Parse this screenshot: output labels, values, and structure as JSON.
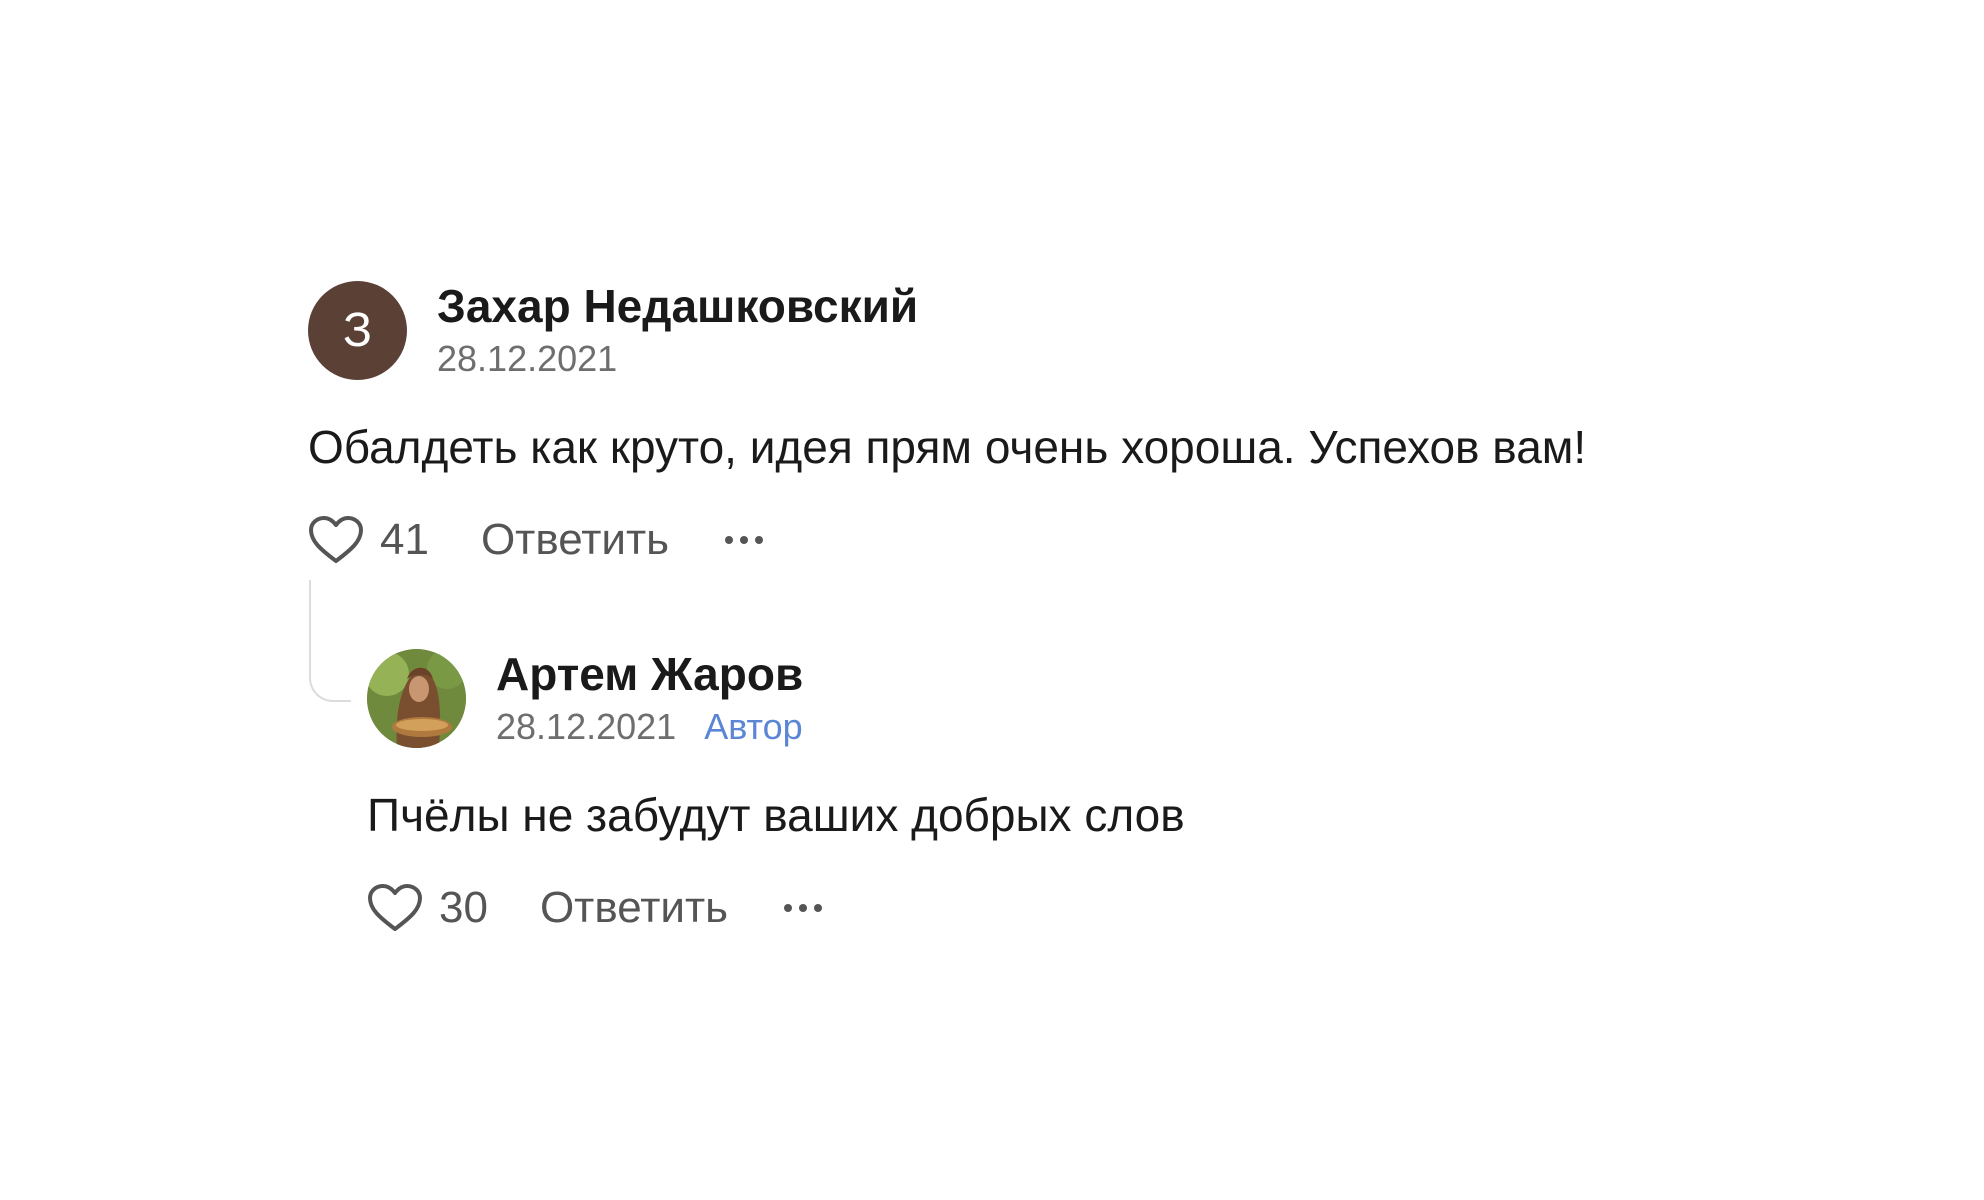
{
  "comment": {
    "avatar_letter": "З",
    "author": "Захар Недашковский",
    "date": "28.12.2021",
    "text": "Обалдеть как круто, идея прям очень хороша. Успехов вам!",
    "likes": "41",
    "reply_label": "Ответить",
    "colors": {
      "avatar_bg": "#5b4036"
    }
  },
  "reply": {
    "author": "Артем Жаров",
    "date": "28.12.2021",
    "badge": "Автор",
    "text": "Пчёлы не забудут ваших добрых слов",
    "likes": "30",
    "reply_label": "Ответить",
    "colors": {
      "badge": "#5b86d6"
    }
  },
  "icons": {
    "like": "heart-outline-icon",
    "more": "ellipsis-icon"
  }
}
